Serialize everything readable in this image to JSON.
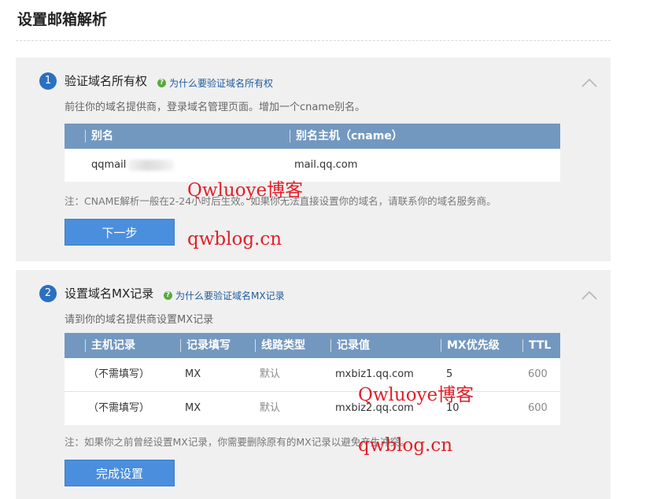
{
  "page": {
    "title": "设置邮箱解析"
  },
  "step1": {
    "number": "1",
    "title": "验证域名所有权",
    "help_link": "为什么要验证域名所有权",
    "description": "前往你的域名提供商，登录域名管理页面。增加一个cname别名。",
    "table": {
      "headers": [
        "别名",
        "别名主机（cname）"
      ],
      "rows": [
        {
          "alias": "qqmail",
          "host": "mail.qq.com"
        }
      ]
    },
    "note": "注：CNAME解析一般在2-24小时后生效。如果你无法直接设置你的域名，请联系你的域名服务商。",
    "button": "下一步"
  },
  "step2": {
    "number": "2",
    "title": "设置域名MX记录",
    "help_link": "为什么要验证域名MX记录",
    "description": "请到你的域名提供商设置MX记录",
    "table": {
      "headers": [
        "主机记录",
        "记录填写",
        "线路类型",
        "记录值",
        "MX优先级",
        "TTL"
      ],
      "rows": [
        {
          "host": "（不需填写）",
          "type": "MX",
          "line": "默认",
          "value": "mxbiz1.qq.com",
          "priority": "5",
          "ttl": "600"
        },
        {
          "host": "（不需填写）",
          "type": "MX",
          "line": "默认",
          "value": "mxbiz2.qq.com",
          "priority": "10",
          "ttl": "600"
        }
      ]
    },
    "note": "注：如果你之前曾经设置MX记录，你需要删除原有的MX记录以避免产生冲突。",
    "button": "完成设置"
  },
  "watermarks": [
    "Qwluoye博客",
    "qwblog.cn",
    "Qwluoye博客",
    "qwblog.cn"
  ],
  "colors": {
    "accent": "#2a6fc2",
    "table_header": "#7398bf",
    "button": "#4a8fdd",
    "watermark": "#e0202a"
  },
  "icons": {
    "help": "question-circle-icon",
    "collapse": "chevron-up-icon"
  }
}
